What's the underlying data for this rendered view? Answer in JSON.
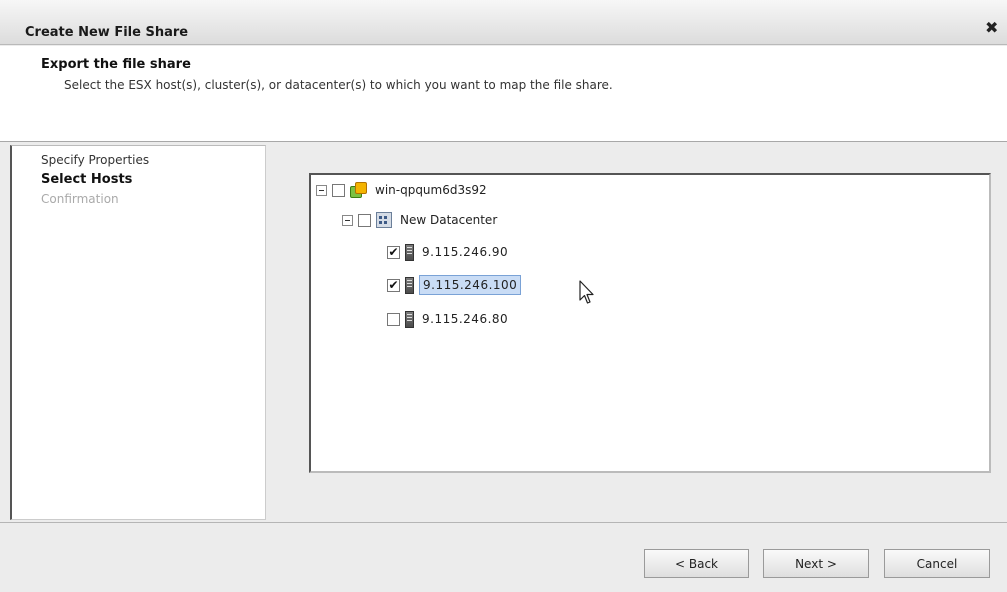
{
  "dialog": {
    "title": "Create New File Share",
    "close_glyph": "✖"
  },
  "header": {
    "heading": "Export the file share",
    "description": "Select the ESX host(s), cluster(s), or datacenter(s) to which you want to map the file share."
  },
  "steps": [
    {
      "label": "Specify Properties",
      "state": "done"
    },
    {
      "label": "Select Hosts",
      "state": "current"
    },
    {
      "label": "Confirmation",
      "state": "pending"
    }
  ],
  "tree": {
    "root": {
      "label": "win-qpqum6d3s92",
      "icon": "vcenter-icon",
      "checked": false,
      "expanded": true
    },
    "datacenter": {
      "label": "New Datacenter",
      "icon": "datacenter-icon",
      "checked": false,
      "expanded": true
    },
    "hosts": [
      {
        "label": "9.115.246.90",
        "icon": "host-icon",
        "checked": true,
        "selected": false
      },
      {
        "label": "9.115.246.100",
        "icon": "host-icon",
        "checked": true,
        "selected": true
      },
      {
        "label": "9.115.246.80",
        "icon": "host-icon",
        "checked": false,
        "selected": false
      }
    ]
  },
  "buttons": {
    "back": "< Back",
    "next": "Next >",
    "cancel": "Cancel"
  },
  "check_glyph": "✔"
}
